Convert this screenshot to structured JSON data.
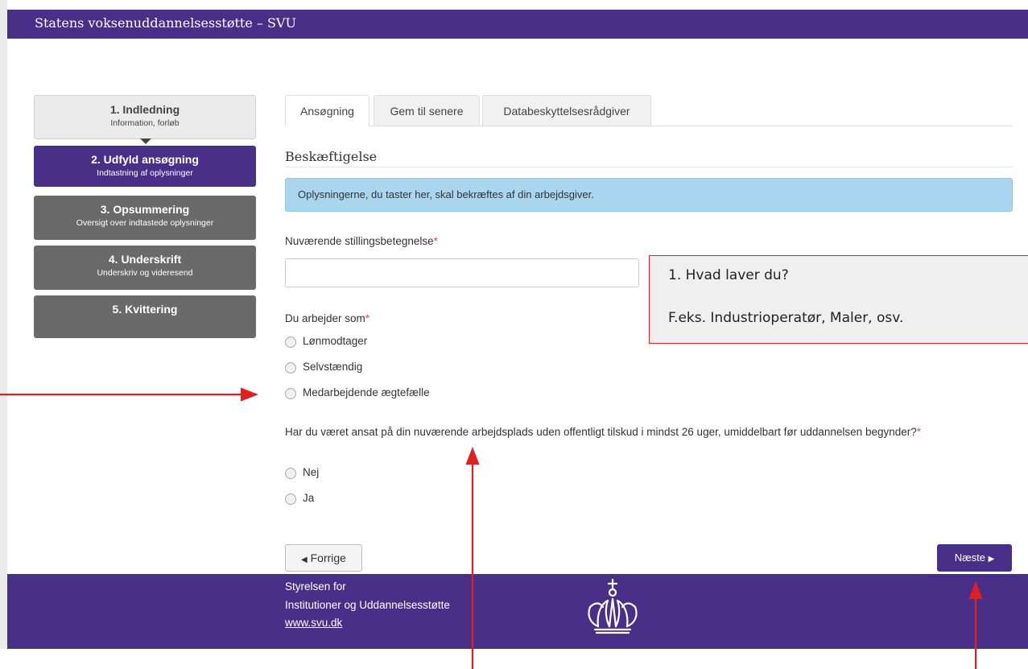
{
  "header": {
    "title": "Statens voksenuddannelsesstøtte – SVU"
  },
  "steps": [
    {
      "title": "1. Indledning",
      "subtitle": "Information, forløb",
      "state": "done"
    },
    {
      "title": "2. Udfyld ansøgning",
      "subtitle": "Indtastning af oplysninger",
      "state": "active"
    },
    {
      "title": "3. Opsummering",
      "subtitle": "Oversigt over indtastede oplysninger",
      "state": "todo"
    },
    {
      "title": "4. Underskrift",
      "subtitle": "Underskriv og videresend",
      "state": "todo"
    },
    {
      "title": "5. Kvittering",
      "subtitle": "",
      "state": "todo"
    }
  ],
  "tabs": [
    {
      "label": "Ansøgning",
      "selected": true
    },
    {
      "label": "Gem til senere",
      "selected": false
    },
    {
      "label": "Databeskyttelsesrådgiver",
      "selected": false
    }
  ],
  "section": {
    "heading": "Beskæftigelse",
    "info": "Oplysningerne, du taster her, skal bekræftes af din arbejdsgiver."
  },
  "form": {
    "job_title_label": "Nuværende stillingsbetegnelse",
    "job_title_value": "",
    "required_mark": "*",
    "work_as_label": "Du arbejder som",
    "work_as_options": [
      "Lønmodtager",
      "Selvstændig",
      "Medarbejdende ægtefælle"
    ],
    "employment_question": "Har du været ansat på din nuværende arbejdsplads uden offentligt tilskud i mindst 26 uger, umiddelbart før uddannelsen begynder?",
    "employment_options": [
      "Nej",
      "Ja"
    ]
  },
  "nav": {
    "prev_label": "Forrige",
    "next_label": "Næste",
    "prev_icon": "caret-left-icon",
    "next_icon": "caret-right-icon"
  },
  "footer": {
    "line1": "Styrelsen for",
    "line2": "Institutioner og Uddannelsesstøtte",
    "link": "www.svu.dk",
    "logo_icon": "crown-logo-icon"
  },
  "callout": {
    "line1": "1. Hvad laver du?",
    "line2": "F.eks. Industrioperatør, Maler, osv."
  },
  "colors": {
    "brand": "#4a2f89",
    "info_bg": "#a9d5ee",
    "annotation": "#e02020",
    "required": "#d9534f"
  }
}
